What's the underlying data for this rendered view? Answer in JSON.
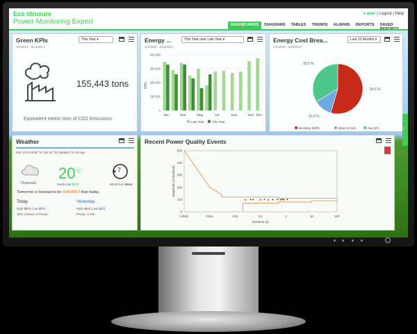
{
  "header": {
    "brand_line1": "Eco struxure",
    "brand_line2": "Power Monitoring Expert",
    "user_label": "user",
    "logout": "Logout",
    "help": "Help",
    "separator": "|"
  },
  "nav": {
    "tabs": [
      "DASHBOARDS",
      "DIAGRAMS",
      "TABLES",
      "TRENDS",
      "ALARMS",
      "REPORTS",
      "SAVED REPORTS"
    ],
    "active": "DASHBOARDS"
  },
  "green_kpis": {
    "title": "Green KPIs",
    "date": "1/1/2017 - 6/13/2017",
    "select": "This Year",
    "value": "155,443 tons",
    "caption": "Equivalent metric tons of CO2 Emissions"
  },
  "energy": {
    "title": "Energy ...",
    "date": "1/1/2016 - 6/13/2017",
    "select": "This Year over Last Year",
    "ylabel": "kWh",
    "legend_last": "Last Year",
    "legend_this": "This Year",
    "colors": {
      "last": "#9fd98f",
      "this": "#3f8f3a"
    }
  },
  "cost": {
    "title": "Energy Cost Brea...",
    "date": "7/1/2016 - 6/13/2017",
    "select": "Last 12 Months",
    "labels": [
      "33.5 %",
      "54.5 %",
      "12.0 %"
    ],
    "legend": [
      "Electricity (kWh)",
      "Water (Litres)",
      "Gas (m³)"
    ],
    "colors": [
      "#c62b1a",
      "#6fa9e0",
      "#4ec88a"
    ]
  },
  "weather": {
    "title": "Weather",
    "line": "Elev 19 m 48.65 °N, 123.43 °W  Updated 72 min ago",
    "condition": "Overcast",
    "temp": "20",
    "unit": "°C",
    "feels_label": "Feels Like",
    "feels_value": "20°C",
    "wind_speed": "7",
    "wind_label": "Wind from",
    "wind_dir": "West",
    "forecast_pre": "Tomorrow is forecast to be",
    "forecast_word": "WARMER",
    "forecast_post": "than today.",
    "today_label": "Today",
    "today_high": "High",
    "today_high_val": "16°C",
    "today_low": "Low",
    "today_low_val": "13°C",
    "today_precip": "30% Chance of Precip.",
    "yest_label": "Yesterday",
    "yest_high": "High",
    "yest_high_val": "15°C",
    "yest_low": "Low",
    "yest_low_val": "14°C",
    "yest_precip": "Precip. 0 mm"
  },
  "pq": {
    "title": "Recent Power Quality Events",
    "ylabel": "Magnitude (% Nominal)",
    "xlabel": "Duration (s)",
    "yticks": [
      "500",
      "400",
      "300",
      "200",
      "100",
      "0"
    ],
    "xticks": [
      "0.0001",
      "0.001",
      "0.01",
      "0.1",
      "1",
      "10",
      "100"
    ]
  },
  "chart_data": [
    {
      "type": "bar",
      "title": "Energy ...",
      "ylabel": "kWh",
      "categories": [
        "Jan",
        "Feb",
        "Mar",
        "Apr",
        "May",
        "Jun",
        "Jul",
        "Aug",
        "Sep",
        "Oct",
        "Nov",
        "Dec"
      ],
      "ylim": [
        0,
        400000
      ],
      "yticks": [
        "400,000",
        "300,000",
        "200,000",
        "100,000",
        "0"
      ],
      "series": [
        {
          "name": "Last Year",
          "values": [
            350000,
            290000,
            340000,
            250000,
            300000,
            180000,
            280000,
            285000,
            270000,
            280000,
            355000,
            375000
          ]
        },
        {
          "name": "This Year",
          "values": [
            330000,
            260000,
            330000,
            230000,
            160000,
            260000,
            0,
            0,
            0,
            0,
            0,
            0
          ]
        }
      ]
    },
    {
      "type": "pie",
      "title": "Energy Cost Brea...",
      "categories": [
        "Electricity (kWh)",
        "Water (Litres)",
        "Gas (m³)"
      ],
      "values": [
        54.5,
        12.0,
        33.5
      ]
    }
  ]
}
